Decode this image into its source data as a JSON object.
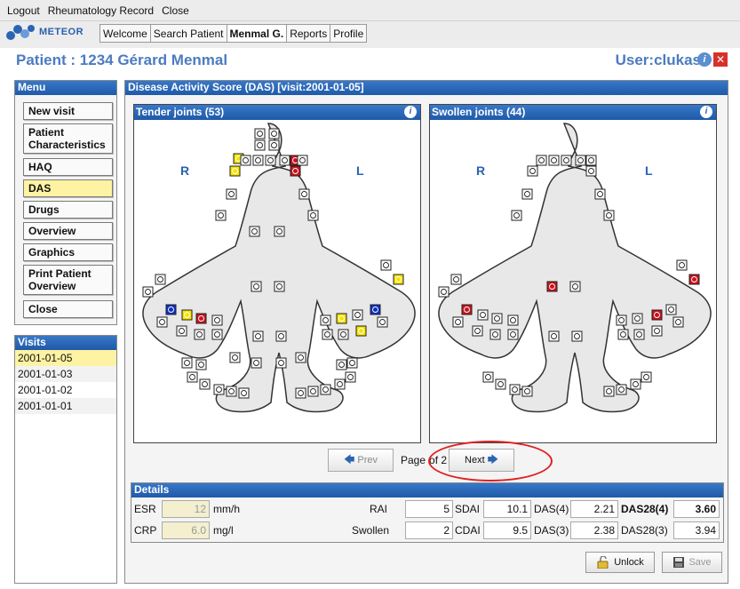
{
  "menubar": {
    "items": [
      "Logout",
      "Rheumatology Record",
      "Close"
    ]
  },
  "app": {
    "logo_text": "METEOR"
  },
  "tabs": [
    {
      "label": "Welcome",
      "active": false
    },
    {
      "label": "Search Patient",
      "active": false
    },
    {
      "label": "Menmal G.",
      "active": true
    },
    {
      "label": "Reports",
      "active": false
    },
    {
      "label": "Profile",
      "active": false
    }
  ],
  "patient": {
    "title": "Patient : 1234 Gérard Menmal"
  },
  "user": {
    "title": "User:clukas"
  },
  "menu": {
    "header": "Menu",
    "items": [
      "New visit",
      "Patient Characteristics",
      "HAQ",
      "DAS",
      "Drugs",
      "Overview",
      "Graphics",
      "Print Patient Overview",
      "Close"
    ],
    "selected": "DAS"
  },
  "visits": {
    "header": "Visits",
    "items": [
      "2001-01-05",
      "2001-01-03",
      "2001-01-02",
      "2001-01-01"
    ],
    "selected": "2001-01-05"
  },
  "das": {
    "header": "Disease Activity Score (DAS) [visit:2001-01-05]",
    "tender": {
      "title": "Tender joints (53)",
      "right_label": "R",
      "left_label": "L"
    },
    "swollen": {
      "title": "Swollen joints (44)",
      "right_label": "R",
      "left_label": "L"
    }
  },
  "pager": {
    "prev": "Prev",
    "page_label": "Page",
    "of_label": "of 2",
    "next": "Next"
  },
  "details": {
    "header": "Details",
    "esr": {
      "label": "ESR",
      "value": "12",
      "unit": "mm/h"
    },
    "crp": {
      "label": "CRP",
      "value": "6.0",
      "unit": "mg/l"
    },
    "rai": {
      "label": "RAI",
      "value": "5"
    },
    "swollen": {
      "label": "Swollen",
      "value": "2"
    },
    "sdai": {
      "label": "SDAI",
      "value": "10.1"
    },
    "cdai": {
      "label": "CDAI",
      "value": "9.5"
    },
    "das4": {
      "label": "DAS(4)",
      "value": "2.21"
    },
    "das3": {
      "label": "DAS(3)",
      "value": "2.38"
    },
    "das28_4": {
      "label": "DAS28(4)",
      "value": "3.60"
    },
    "das28_3": {
      "label": "DAS28(3)",
      "value": "3.94"
    }
  },
  "buttons": {
    "unlock": "Unlock",
    "save": "Save"
  },
  "colors": {
    "accent": "#2b64b2",
    "selected": "#fdf3a3",
    "joint_yellow": "#f5e400",
    "joint_red": "#c8141e",
    "joint_blue": "#1030c0"
  }
}
